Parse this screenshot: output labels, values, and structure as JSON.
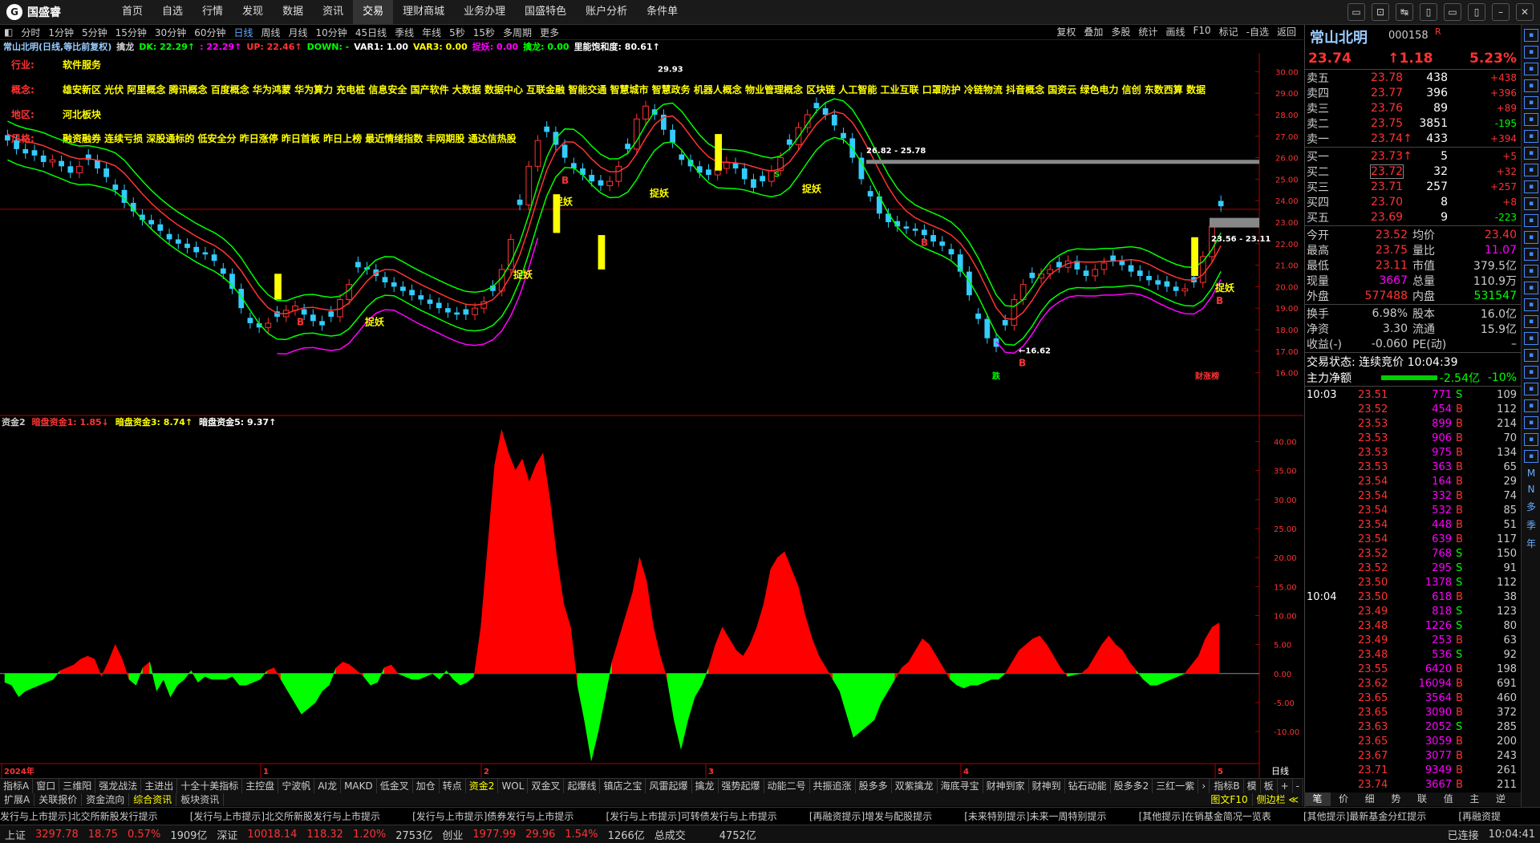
{
  "app": {
    "name": "国盛睿"
  },
  "menu": [
    "首页",
    "自选",
    "行情",
    "发现",
    "数据",
    "资讯",
    "交易",
    "理财商城",
    "业务办理",
    "国盛特色",
    "账户分析",
    "条件单"
  ],
  "menu_active": "交易",
  "window_controls": [
    "▭",
    "⊡",
    "↹",
    "▯",
    "▭",
    "▯",
    "–",
    "✕"
  ],
  "periods": [
    "分时",
    "1分钟",
    "5分钟",
    "15分钟",
    "30分钟",
    "60分钟",
    "日线",
    "周线",
    "月线",
    "10分钟",
    "45日线",
    "季线",
    "年线",
    "5秒",
    "15秒",
    "多周期",
    "更多"
  ],
  "period_active": "日线",
  "right_buttons": [
    "复权",
    "叠加",
    "多股",
    "统计",
    "画线",
    "F10",
    "标记",
    "-自选",
    "返回"
  ],
  "indicator_line": [
    {
      "text": "常山北明(日线,等比前复权)",
      "color": "#9cf"
    },
    {
      "text": "擒龙",
      "color": "#ccc"
    },
    {
      "text": "DK: 22.29↑",
      "color": "#0f0"
    },
    {
      "text": ": 22.29↑",
      "color": "#f0f"
    },
    {
      "text": "UP: 22.46↑",
      "color": "#f33"
    },
    {
      "text": "DOWN: -",
      "color": "#0f0"
    },
    {
      "text": "VAR1: 1.00",
      "color": "#fff"
    },
    {
      "text": "VAR3: 0.00",
      "color": "#ff0"
    },
    {
      "text": "捉妖: 0.00",
      "color": "#f0f"
    },
    {
      "text": "擒龙: 0.00",
      "color": "#0f0"
    },
    {
      "text": "里能饱和度: 80.61↑",
      "color": "#fff"
    }
  ],
  "info": {
    "industry_label": "行业:",
    "industry": "软件服务",
    "concept_label": "概念:",
    "concept": "雄安新区 光伏 阿里概念 腾讯概念 百度概念 华为鸿蒙 华为算力 充电桩 信息安全 国产软件 大数据 数据中心 互联金融 智能交通 智慧城市 智慧政务 机器人概念 物业管理概念 区块链 人工智能 工业互联 口罩防护 冷链物流 抖音概念 国资云 绿色电力 信创 东数西算 数据",
    "region_label": "地区:",
    "region": "河北板块",
    "style_label": "风格:",
    "style": "融资融券 连续亏损 深股通标的 低安全分 昨日涨停 昨日首板 昨日上榜 最近情绪指数 丰网期股 通达信热股"
  },
  "chart_data": [
    {
      "type": "candlestick",
      "title": "常山北明(日线,等比前复权)",
      "ylim": [
        15.5,
        30.5
      ],
      "y_ticks": [
        "30.00",
        "29.00",
        "28.00",
        "27.00",
        "26.00",
        "25.00",
        "24.00",
        "23.00",
        "22.00",
        "21.00",
        "20.00",
        "19.00",
        "18.00",
        "17.00",
        "16.00"
      ],
      "x_labels": [
        "2024年",
        "1",
        "2",
        "3",
        "4",
        "5"
      ],
      "annotations": [
        "29.93",
        "26.82 - 25.78",
        "23.56 - 23.11",
        "←16.62",
        "捉妖",
        "捉妖",
        "捉妖",
        "捉妖",
        "捉妖",
        "捉妖",
        "B",
        "B",
        "B",
        "B",
        "B",
        "S",
        "跌",
        "财涨榜"
      ],
      "close": [
        26.8,
        26.4,
        26.2,
        26.1,
        25.8,
        25.9,
        25.6,
        25.3,
        25.6,
        25.9,
        25.5,
        25.1,
        24.5,
        23.9,
        23.5,
        23.1,
        22.9,
        22.6,
        22.2,
        22.0,
        21.8,
        21.6,
        21.5,
        21.2,
        20.6,
        19.9,
        19.0,
        18.3,
        18.1,
        18.3,
        18.6,
        18.9,
        19.1,
        18.7,
        18.4,
        18.2,
        18.6,
        19.4,
        20.1,
        20.9,
        20.8,
        20.5,
        20.2,
        20.0,
        19.8,
        19.6,
        19.4,
        19.2,
        19.0,
        18.8,
        18.7,
        18.7,
        19.0,
        19.3,
        19.8,
        20.8,
        22.2,
        23.8,
        25.6,
        26.8,
        27.2,
        26.6,
        26.0,
        25.5,
        25.2,
        24.9,
        24.7,
        24.9,
        25.6,
        26.4,
        27.8,
        28.4,
        28.0,
        27.3,
        26.7,
        25.9,
        25.6,
        25.3,
        25.2,
        25.5,
        25.8,
        25.5,
        25.0,
        24.6,
        24.9,
        25.4,
        26.0,
        26.6,
        27.4,
        28.0,
        28.3,
        28.0,
        27.5,
        26.9,
        26.0,
        25.0,
        24.2,
        23.4,
        23.0,
        22.8,
        22.7,
        22.6,
        22.4,
        22.1,
        21.9,
        21.5,
        20.7,
        19.6,
        18.5,
        17.6,
        17.2,
        18.2,
        19.4,
        20.1,
        20.4,
        20.6,
        20.8,
        20.9,
        21.2,
        20.8,
        20.5,
        20.8,
        21.1,
        21.2,
        21.0,
        20.7,
        20.5,
        20.3,
        20.1,
        20.0,
        19.8,
        19.9,
        20.2,
        21.4,
        22.8,
        23.74
      ]
    },
    {
      "type": "bar",
      "title": "资金2",
      "series_labels": [
        {
          "text": "资金2",
          "color": "#ccc"
        },
        {
          "text": "暗盘资金1: 1.85↓",
          "color": "#f33"
        },
        {
          "text": "暗盘资金3: 8.74↑",
          "color": "#ff0"
        },
        {
          "text": "暗盘资金5: 9.37↑",
          "color": "#fff"
        }
      ],
      "ylim": [
        -14,
        42
      ],
      "y_ticks": [
        "40.00",
        "35.00",
        "30.00",
        "25.00",
        "20.00",
        "15.00",
        "10.00",
        "5.00",
        "0.00",
        "-5.00",
        "-10.00"
      ],
      "values": [
        -1.5,
        -2,
        -4,
        -3,
        -2.5,
        -2,
        -1.5,
        -1,
        0.5,
        1,
        1.5,
        2.5,
        3,
        2.5,
        -0.5,
        2,
        5,
        2.5,
        -1,
        -2,
        1,
        2,
        -3,
        -1,
        -4,
        -2,
        -1,
        0.5,
        -1.5,
        -0.5,
        -1,
        -1,
        -1,
        -0.5,
        -2,
        -2,
        -1.5,
        -1,
        0.5,
        1,
        -1,
        -3,
        -5,
        -7,
        -6,
        -5,
        -3,
        -2,
        1,
        2,
        1.5,
        0.5,
        -0.5,
        -2,
        -1.5,
        1,
        1.5,
        0,
        -0.5,
        -1,
        -1,
        -0.5,
        0,
        -1,
        0.5,
        -1,
        -2,
        -1.5,
        -0.5,
        8,
        22,
        36,
        42,
        38,
        35,
        37,
        33,
        36,
        38,
        30,
        20,
        12,
        8,
        -2,
        -8,
        -15,
        -10,
        -4,
        2,
        6,
        10,
        14,
        20,
        16,
        8,
        3,
        -1,
        -8,
        -13,
        -8,
        -4,
        -2,
        1,
        5,
        8,
        6,
        4,
        3,
        5,
        8,
        12,
        18,
        20,
        21,
        18,
        15,
        10,
        6,
        3,
        1,
        -1,
        -3,
        -7,
        -11,
        -10,
        -9,
        -8,
        -5,
        -3,
        -1,
        1,
        2,
        4,
        6,
        5,
        3,
        1,
        -1,
        -2,
        -2.5,
        -2,
        -2,
        -1.5,
        -1,
        -1,
        0,
        2,
        4,
        5,
        6,
        6.5,
        5,
        3,
        1,
        -0.5,
        -0.2,
        0,
        1,
        3,
        5,
        6.5,
        5,
        4,
        2,
        0.5,
        -1,
        -2,
        -2,
        -1.5,
        -1,
        -0.5,
        0,
        1.5,
        3,
        6,
        8,
        8.74
      ]
    }
  ],
  "bottom_tabs": [
    "指标A",
    "窗口",
    "三维阳",
    "强龙战法",
    "主进出",
    "十全十美指标",
    "主控盘",
    "宁波帆",
    "AI龙",
    "MAKD",
    "低金叉",
    "加仓",
    "转点",
    "资金2",
    "WOL",
    "双金叉",
    "起爆线",
    "镇店之宝",
    "风雷起爆",
    "擒龙",
    "强势起爆",
    "动能二号",
    "共振追涨",
    "股多多",
    "双紫擒龙",
    "海底寻宝",
    "财神到家",
    "财神到",
    "钻石动能",
    "股多多2",
    "三红一紫",
    "›"
  ],
  "bottom_tabs_active": "资金2",
  "bottom_tabs_right": [
    "指标B",
    "模",
    "板",
    "+",
    "-"
  ],
  "bottom_tabs2": [
    "扩展A",
    "关联报价",
    "资金流向",
    "综合资讯",
    "板块资讯"
  ],
  "bottom_tabs2_active": "综合资讯",
  "bottom_tabs2_right": [
    "图文F10",
    "侧边栏 ≪"
  ],
  "ticker": [
    "发行与上市提示]北交所新股发行提示",
    "[发行与上市提示]北交所新股发行与上市提示",
    "[发行与上市提示]债券发行与上市提示",
    "[发行与上市提示]可转债发行与上市提示",
    "[再融资提示]增发与配股提示",
    "[未来特别提示]未来一周特别提示",
    "[其他提示]在销基金简况一览表",
    "[其他提示]最新基金分红提示",
    "[再融资提"
  ],
  "status": [
    {
      "text": "上证",
      "color": "#ccc"
    },
    {
      "text": "3297.78",
      "color": "#f33"
    },
    {
      "text": "18.75",
      "color": "#f33"
    },
    {
      "text": "0.57%",
      "color": "#f33"
    },
    {
      "text": "1909亿",
      "color": "#ccc"
    },
    {
      "text": "深证",
      "color": "#ccc"
    },
    {
      "text": "10018.14",
      "color": "#f33"
    },
    {
      "text": "118.32",
      "color": "#f33"
    },
    {
      "text": "1.20%",
      "color": "#f33"
    },
    {
      "text": "2753亿",
      "color": "#ccc"
    },
    {
      "text": "创业",
      "color": "#ccc"
    },
    {
      "text": "1977.99",
      "color": "#f33"
    },
    {
      "text": "29.96",
      "color": "#f33"
    },
    {
      "text": "1.54%",
      "color": "#f33"
    },
    {
      "text": "1266亿",
      "color": "#ccc"
    },
    {
      "text": "总成交",
      "color": "#ccc"
    },
    {
      "text": "4752亿",
      "color": "#ccc"
    },
    {
      "text": "已连接",
      "color": "#ccc"
    },
    {
      "text": "10:04:41",
      "color": "#ccc"
    }
  ],
  "right_panel": {
    "name": "常山北明",
    "code": "000158",
    "tag": "R",
    "price": "23.74",
    "change": "↑1.18",
    "pct": "5.23%",
    "sells": [
      {
        "label": "卖五",
        "price": "23.78",
        "vol": "438",
        "chg": "+438"
      },
      {
        "label": "卖四",
        "price": "23.77",
        "vol": "396",
        "chg": "+396"
      },
      {
        "label": "卖三",
        "price": "23.76",
        "vol": "89",
        "chg": "+89"
      },
      {
        "label": "卖二",
        "price": "23.75",
        "vol": "3851",
        "chg": "-195"
      },
      {
        "label": "卖一",
        "price": "23.74↑",
        "vol": "433",
        "chg": "+394"
      }
    ],
    "buys": [
      {
        "label": "买一",
        "price": "23.73↑",
        "vol": "5",
        "chg": "+5"
      },
      {
        "label": "买二",
        "price": "23.72",
        "vol": "32",
        "chg": "+32"
      },
      {
        "label": "买三",
        "price": "23.71",
        "vol": "257",
        "chg": "+257"
      },
      {
        "label": "买四",
        "price": "23.70",
        "vol": "8",
        "chg": "+8"
      },
      {
        "label": "买五",
        "price": "23.69",
        "vol": "9",
        "chg": "-223"
      }
    ],
    "stats": [
      {
        "l1": "今开",
        "v1": "23.52",
        "c1": "#f33",
        "l2": "均价",
        "v2": "23.40",
        "c2": "#f33"
      },
      {
        "l1": "最高",
        "v1": "23.75",
        "c1": "#f33",
        "l2": "量比",
        "v2": "11.07",
        "c2": "#f0f"
      },
      {
        "l1": "最低",
        "v1": "23.11",
        "c1": "#f33",
        "l2": "市值",
        "v2": "379.5亿",
        "c2": "#ccc"
      },
      {
        "l1": "现量",
        "v1": "3667",
        "c1": "#f0f",
        "l2": "总量",
        "v2": "110.9万",
        "c2": "#ccc"
      },
      {
        "l1": "外盘",
        "v1": "577488",
        "c1": "#f33",
        "l2": "内盘",
        "v2": "531547",
        "c2": "#0f0"
      }
    ],
    "stats2": [
      {
        "l1": "换手",
        "v1": "6.98%",
        "c1": "#ccc",
        "l2": "股本",
        "v2": "16.0亿",
        "c2": "#ccc"
      },
      {
        "l1": "净资",
        "v1": "3.30",
        "c1": "#ccc",
        "l2": "流通",
        "v2": "15.9亿",
        "c2": "#ccc"
      },
      {
        "l1": "收益(-)",
        "v1": "-0.060",
        "c1": "#ccc",
        "l2": "PE(动)",
        "v2": "–",
        "c2": "#ccc"
      }
    ],
    "trade_status": "交易状态: 连续竞价 10:04:39",
    "main_flow_label": "主力净额",
    "main_flow_value": "-2.54亿",
    "main_flow_pct": "-10%",
    "ticks_time1": "10:03",
    "ticks_time2": "10:04",
    "ticks": [
      {
        "p": "23.51",
        "v": "771",
        "s": "S",
        "n": "109"
      },
      {
        "p": "23.52",
        "v": "454",
        "s": "B",
        "n": "112"
      },
      {
        "p": "23.53",
        "v": "899",
        "s": "B",
        "n": "214"
      },
      {
        "p": "23.53",
        "v": "906",
        "s": "B",
        "n": "70"
      },
      {
        "p": "23.53",
        "v": "975",
        "s": "B",
        "n": "134"
      },
      {
        "p": "23.53",
        "v": "363",
        "s": "B",
        "n": "65"
      },
      {
        "p": "23.54",
        "v": "164",
        "s": "B",
        "n": "29"
      },
      {
        "p": "23.54",
        "v": "332",
        "s": "B",
        "n": "74"
      },
      {
        "p": "23.54",
        "v": "532",
        "s": "B",
        "n": "85"
      },
      {
        "p": "23.54",
        "v": "448",
        "s": "B",
        "n": "51"
      },
      {
        "p": "23.54",
        "v": "639",
        "s": "B",
        "n": "117"
      },
      {
        "p": "23.52",
        "v": "768",
        "s": "S",
        "n": "150"
      },
      {
        "p": "23.52",
        "v": "295",
        "s": "S",
        "n": "91"
      },
      {
        "p": "23.50",
        "v": "1378",
        "s": "S",
        "n": "112"
      },
      {
        "p": "23.50",
        "v": "618",
        "s": "B",
        "n": "38"
      },
      {
        "p": "23.49",
        "v": "818",
        "s": "S",
        "n": "123"
      },
      {
        "p": "23.48",
        "v": "1226",
        "s": "S",
        "n": "80"
      },
      {
        "p": "23.49",
        "v": "253",
        "s": "B",
        "n": "63"
      },
      {
        "p": "23.48",
        "v": "536",
        "s": "S",
        "n": "92"
      },
      {
        "p": "23.55",
        "v": "6420",
        "s": "B",
        "n": "198"
      },
      {
        "p": "23.62",
        "v": "16094",
        "s": "B",
        "n": "691"
      },
      {
        "p": "23.65",
        "v": "3564",
        "s": "B",
        "n": "460"
      },
      {
        "p": "23.65",
        "v": "3090",
        "s": "B",
        "n": "372"
      },
      {
        "p": "23.63",
        "v": "2052",
        "s": "S",
        "n": "285"
      },
      {
        "p": "23.65",
        "v": "3059",
        "s": "B",
        "n": "200"
      },
      {
        "p": "23.67",
        "v": "3077",
        "s": "B",
        "n": "243"
      },
      {
        "p": "23.71",
        "v": "9349",
        "s": "B",
        "n": "261"
      },
      {
        "p": "23.74",
        "v": "3667",
        "s": "B",
        "n": "211"
      }
    ],
    "tabs": [
      "笔",
      "价",
      "细",
      "势",
      "联",
      "值",
      "主",
      "逆",
      "▪"
    ],
    "tabs_active": "笔"
  },
  "right_bar_text": [
    "M",
    "N",
    "多",
    "季",
    "年"
  ]
}
